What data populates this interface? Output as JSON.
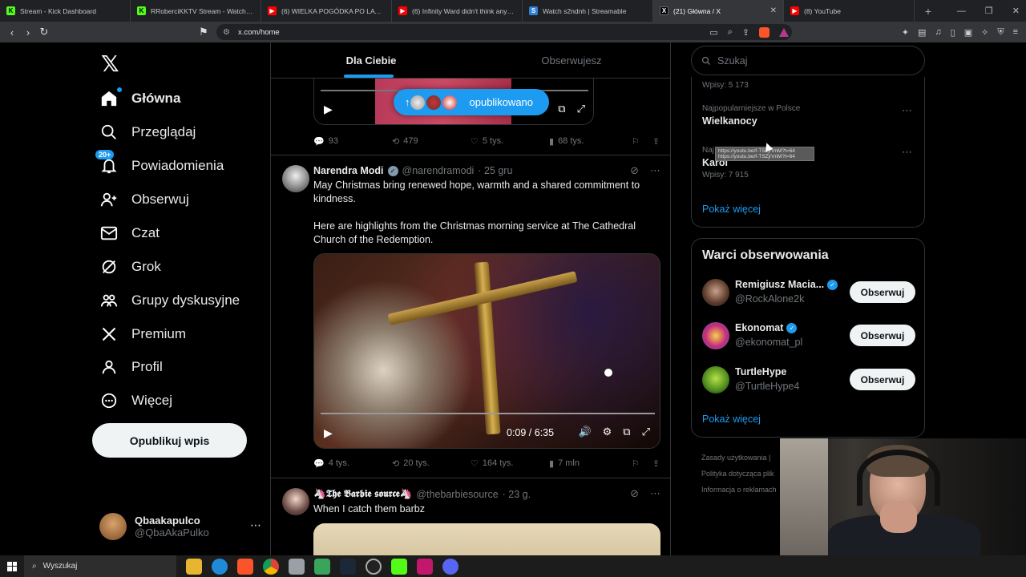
{
  "browser": {
    "tabs": [
      {
        "title": "Stream - Kick Dashboard",
        "color": "#53fc18",
        "glyph": "K"
      },
      {
        "title": "RRoberciKKTV Stream - Watch Live o",
        "color": "#53fc18",
        "glyph": "K"
      },
      {
        "title": "(6) WIELKA POGÓDKA PO LATACH (l",
        "color": "#ff0000",
        "glyph": "▶"
      },
      {
        "title": "(6) Infinity Ward didn't think anyone",
        "color": "#ff0000",
        "glyph": "▶"
      },
      {
        "title": "Watch s2ndnh | Streamable",
        "color": "#2f7fd6",
        "glyph": "S"
      },
      {
        "title": "(21) Główna / X",
        "color": "#000000",
        "glyph": "X"
      },
      {
        "title": "(8) YouTube",
        "color": "#ff0000",
        "glyph": "▶"
      }
    ],
    "active_tab_close": "✕",
    "new_tab": "+",
    "url": "x.com/home"
  },
  "nav": {
    "logo": "𝕏",
    "items": [
      {
        "label": "Główna",
        "icon": "home-icon",
        "glyph": "⌂",
        "bold": true
      },
      {
        "label": "Przeglądaj",
        "icon": "search-icon",
        "glyph": "⌕"
      },
      {
        "label": "Powiadomienia",
        "icon": "bell-icon",
        "glyph": "🔔",
        "badge": "20+"
      },
      {
        "label": "Obserwuj",
        "icon": "follow-icon",
        "glyph": "👤"
      },
      {
        "label": "Czat",
        "icon": "mail-icon",
        "glyph": "✉"
      },
      {
        "label": "Grok",
        "icon": "grok-icon",
        "glyph": "⊘"
      },
      {
        "label": "Grupy dyskusyjne",
        "icon": "communities-icon",
        "glyph": "👥"
      },
      {
        "label": "Premium",
        "icon": "x-premium-icon",
        "glyph": "𝕏"
      },
      {
        "label": "Profil",
        "icon": "profile-icon",
        "glyph": "👤"
      },
      {
        "label": "Więcej",
        "icon": "more-icon",
        "glyph": "⋯"
      }
    ],
    "post_button": "Opublikuj wpis",
    "account": {
      "name": "Qbaakapulco",
      "handle": "@QbaAkaPulko",
      "more": "⋯"
    }
  },
  "timeline": {
    "tabs": [
      "Dla Ciebie",
      "Obserwujesz"
    ],
    "new_posts_pill": "opublikowano",
    "tweet0": {
      "replies": "93",
      "reposts": "479",
      "likes": "5 tys.",
      "views": "68 tys."
    },
    "tweet1": {
      "name": "Narendra Modi",
      "handle": "@narendramodi",
      "time": "· 25 gru",
      "text": "May Christmas bring renewed hope, warmth and a shared commitment to kindness.\n\nHere are highlights from the Christmas morning service at The Cathedral Church of the Redemption.",
      "video_time": "0:09 / 6:35",
      "replies": "4 tys.",
      "reposts": "20 tys.",
      "likes": "164 tys.",
      "views": "7 mln"
    },
    "tweet2": {
      "name": "🦄𝕿𝖍𝖊 𝕭𝖆𝖗𝖇𝖎𝖊 𝖘𝖔𝖚𝖗𝖈𝖊🦄",
      "handle": "@thebarbiesource",
      "time": "· 23 g.",
      "text": "When I catch them barbz"
    }
  },
  "sidebar": {
    "search_placeholder": "Szukaj",
    "trends": [
      {
        "context": "",
        "name": "",
        "count": "Wpisy: 5 173"
      },
      {
        "context": "Najpopularniejsze w Polsce",
        "name": "Wielkanocy",
        "count": ""
      },
      {
        "context": "Naj",
        "name": "Karol",
        "count": "Wpisy: 7 915"
      }
    ],
    "trends_more": "Pokaż więcej",
    "tooltip": "https://youtu.be/f-TSZjrVnM?t=64\nhttps://youtu.be/f-TSZjrVnM?t=64",
    "follow_title": "Warci obserwowania",
    "follow": [
      {
        "name": "Remigiusz Macia...",
        "handle": "@RockAlone2k",
        "button": "Obserwuj",
        "verified": "blue"
      },
      {
        "name": "Ekonomat",
        "handle": "@ekonomat_pl",
        "button": "Obserwuj",
        "verified": "blue"
      },
      {
        "name": "TurtleHype",
        "handle": "@TurtleHype4",
        "button": "Obserwuj",
        "verified": ""
      }
    ],
    "follow_more": "Pokaż więcej",
    "footer": [
      "Zasady użytkowania |",
      "Polityka dotycząca plik",
      "Informacja o reklamach"
    ]
  },
  "taskbar": {
    "search": "Wyszukaj"
  }
}
